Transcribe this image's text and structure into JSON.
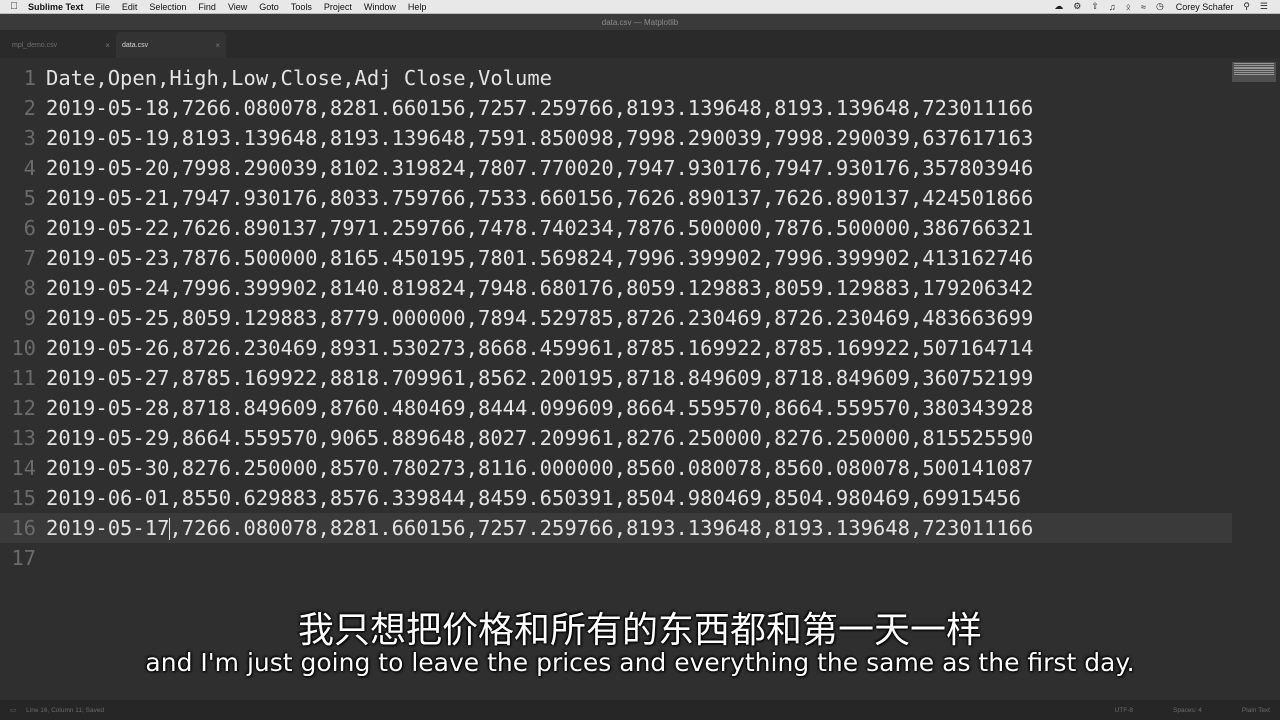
{
  "menubar": {
    "apple_icon": "apple-icon",
    "app_name": "Sublime Text",
    "items": [
      "File",
      "Edit",
      "Selection",
      "Find",
      "View",
      "Goto",
      "Tools",
      "Project",
      "Window",
      "Help"
    ],
    "user": "Corey Schafer"
  },
  "window": {
    "title": "data.csv — Matplotlib"
  },
  "tabs": [
    {
      "label": "mpl_demo.csv",
      "active": false
    },
    {
      "label": "data.csv",
      "active": true
    }
  ],
  "editor": {
    "current_line": 16,
    "lines": [
      {
        "num": "1",
        "text": "Date,Open,High,Low,Close,Adj Close,Volume"
      },
      {
        "num": "2",
        "text": "2019-05-18,7266.080078,8281.660156,7257.259766,8193.139648,8193.139648,723011166"
      },
      {
        "num": "3",
        "text": "2019-05-19,8193.139648,8193.139648,7591.850098,7998.290039,7998.290039,637617163"
      },
      {
        "num": "4",
        "text": "2019-05-20,7998.290039,8102.319824,7807.770020,7947.930176,7947.930176,357803946"
      },
      {
        "num": "5",
        "text": "2019-05-21,7947.930176,8033.759766,7533.660156,7626.890137,7626.890137,424501866"
      },
      {
        "num": "6",
        "text": "2019-05-22,7626.890137,7971.259766,7478.740234,7876.500000,7876.500000,386766321"
      },
      {
        "num": "7",
        "text": "2019-05-23,7876.500000,8165.450195,7801.569824,7996.399902,7996.399902,413162746"
      },
      {
        "num": "8",
        "text": "2019-05-24,7996.399902,8140.819824,7948.680176,8059.129883,8059.129883,179206342"
      },
      {
        "num": "9",
        "text": "2019-05-25,8059.129883,8779.000000,7894.529785,8726.230469,8726.230469,483663699"
      },
      {
        "num": "10",
        "text": "2019-05-26,8726.230469,8931.530273,8668.459961,8785.169922,8785.169922,507164714"
      },
      {
        "num": "11",
        "text": "2019-05-27,8785.169922,8818.709961,8562.200195,8718.849609,8718.849609,360752199"
      },
      {
        "num": "12",
        "text": "2019-05-28,8718.849609,8760.480469,8444.099609,8664.559570,8664.559570,380343928"
      },
      {
        "num": "13",
        "text": "2019-05-29,8664.559570,9065.889648,8027.209961,8276.250000,8276.250000,815525590"
      },
      {
        "num": "14",
        "text": "2019-05-30,8276.250000,8570.780273,8116.000000,8560.080078,8560.080078,500141087"
      },
      {
        "num": "15",
        "text": "2019-06-01,8550.629883,8576.339844,8459.650391,8504.980469,8504.980469,69915456"
      },
      {
        "num": "16",
        "text_before_caret": "2019-05-17",
        "text_after_caret": ",7266.080078,8281.660156,7257.259766,8193.139648,8193.139648,723011166"
      },
      {
        "num": "17",
        "text": ""
      }
    ]
  },
  "subtitles": {
    "zh": "我只想把价格和所有的东西都和第一天一样",
    "en": "and I'm just going to leave the prices and everything the same as the first day."
  },
  "statusbar": {
    "position": "Line 16, Column 11; Saved",
    "encoding": "UTF-8",
    "indent": "Spaces: 4",
    "syntax": "Plain Text"
  }
}
